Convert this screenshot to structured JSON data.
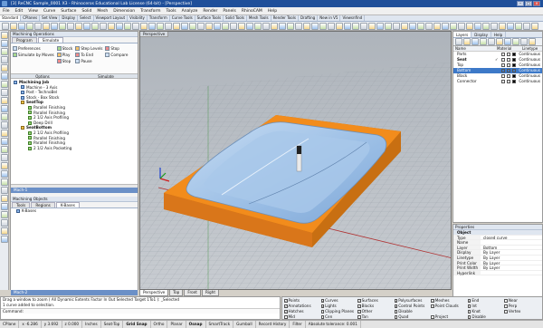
{
  "window": {
    "title": "[3] ReCNC Sample_0001 X3 - Rhinoceros Educational Lab License (64-bit) - [Perspective]"
  },
  "menu": [
    "File",
    "Edit",
    "View",
    "Curve",
    "Surface",
    "Solid",
    "Mesh",
    "Dimension",
    "Transform",
    "Tools",
    "Analyze",
    "Render",
    "Panels",
    "RhinoCAM",
    "Help"
  ],
  "tabs": [
    {
      "label": "Standard",
      "active": true
    },
    {
      "label": "CPlanes"
    },
    {
      "label": "Set View"
    },
    {
      "label": "Display"
    },
    {
      "label": "Select"
    },
    {
      "label": "Viewport Layout"
    },
    {
      "label": "Visibility"
    },
    {
      "label": "Transform"
    },
    {
      "label": "Curve Tools"
    },
    {
      "label": "Surface Tools"
    },
    {
      "label": "Solid Tools"
    },
    {
      "label": "Mesh Tools"
    },
    {
      "label": "Render Tools"
    },
    {
      "label": "Drafting"
    },
    {
      "label": "New in V5"
    },
    {
      "label": "Viewsnfind"
    }
  ],
  "machining": {
    "title": "Machining Operations",
    "tabs": [
      {
        "label": "Program"
      },
      {
        "label": "Simulate",
        "active": true
      }
    ],
    "col1": [
      {
        "label": "Preferences",
        "icon": "preferences-icon"
      },
      {
        "label": "Simulate by Moves",
        "icon": "checkbox-icon"
      }
    ],
    "col2": [
      {
        "label": "Stock",
        "icon": "stock-icon"
      },
      {
        "label": "Play",
        "icon": "play-icon"
      },
      {
        "label": "Stop",
        "icon": "stop-icon"
      }
    ],
    "col3": [
      {
        "label": "Step Levels",
        "icon": "step-levels-icon"
      },
      {
        "label": "To End",
        "icon": "to-end-icon"
      },
      {
        "label": "Pause",
        "icon": "pause-icon"
      }
    ],
    "col4": [
      {
        "label": "Stop",
        "icon": "stop-icon"
      },
      {
        "label": "Compare",
        "icon": "compare-icon"
      }
    ],
    "groups": [
      "Options",
      "Simulate"
    ],
    "tree": [
      {
        "label": "Machining Job",
        "level": 0,
        "bold": true,
        "icon": "job"
      },
      {
        "label": "Machine - 3 Axis",
        "level": 1,
        "icon": "machine"
      },
      {
        "label": "Post - TechnoBel",
        "level": 1,
        "icon": "post"
      },
      {
        "label": "Stock - Box Stock",
        "level": 1,
        "icon": "stock"
      },
      {
        "label": "SeatTop",
        "level": 1,
        "bold": true,
        "icon": "folder"
      },
      {
        "label": "Parallel Finishing",
        "level": 2,
        "icon": "op"
      },
      {
        "label": "Parallel Finishing",
        "level": 2,
        "icon": "op"
      },
      {
        "label": "2 1/2 Axis Profiling",
        "level": 2,
        "icon": "op"
      },
      {
        "label": "Deep Drill",
        "level": 2,
        "icon": "op"
      },
      {
        "label": "SeatBottom",
        "level": 1,
        "bold": true,
        "icon": "folder"
      },
      {
        "label": "2 1/2 Axis Profiling",
        "level": 2,
        "icon": "op"
      },
      {
        "label": "Parallel Finishing",
        "level": 2,
        "icon": "op"
      },
      {
        "label": "Parallel Finishing",
        "level": 2,
        "icon": "op"
      },
      {
        "label": "2 1/2 Axis Pocketing",
        "level": 2,
        "icon": "op"
      }
    ],
    "section_label": "Mach-1"
  },
  "objects": {
    "title": "Machining Objects",
    "tabs": [
      {
        "label": "Tools"
      },
      {
        "label": "Regions"
      },
      {
        "label": "K-Bases",
        "active": true
      }
    ],
    "tree": [
      {
        "label": "K-Bases"
      }
    ],
    "section_label": "Mach-2"
  },
  "viewport": {
    "label": "Perspective",
    "tabs": [
      {
        "label": "Perspective",
        "active": true
      },
      {
        "label": "Top"
      },
      {
        "label": "Front"
      },
      {
        "label": "Right"
      }
    ],
    "stock_color": "#f28c1c",
    "part_color": "#9dbfe2"
  },
  "layers": {
    "tabs": [
      {
        "label": "Layers",
        "active": true
      },
      {
        "label": "Display"
      },
      {
        "label": "Help"
      }
    ],
    "headers": [
      "Name",
      "Material",
      "Linetype"
    ],
    "rows": [
      {
        "name": "Parts",
        "color": "#000000",
        "linetype": "Continuous",
        "current": false
      },
      {
        "name": "Seat",
        "color": "#000000",
        "linetype": "Continuous",
        "current": true,
        "bold": true
      },
      {
        "name": "Top",
        "color": "#000000",
        "linetype": "Continuous",
        "current": false
      },
      {
        "name": "Bottom",
        "color": "#3d79c8",
        "linetype": "Continuous",
        "current": false,
        "selected": true
      },
      {
        "name": "Black",
        "color": "#000000",
        "linetype": "Continuous",
        "current": false
      },
      {
        "name": "Connector",
        "color": "#000000",
        "linetype": "Continuous",
        "current": false
      }
    ]
  },
  "properties": {
    "title": "Properties",
    "section": "Object",
    "rows": [
      {
        "k": "Type",
        "v": "closed curve"
      },
      {
        "k": "Name",
        "v": ""
      },
      {
        "k": "Layer",
        "v": "Bottom"
      },
      {
        "k": "Display Color",
        "v": "By Layer"
      },
      {
        "k": "Linetype",
        "v": "By Layer"
      },
      {
        "k": "Print Color",
        "v": "By Layer"
      },
      {
        "k": "Print Width",
        "v": "By Layer"
      },
      {
        "k": "Hyperlink",
        "v": ""
      }
    ]
  },
  "command": {
    "history": [
      "Drag a window to zoom ( All  Dynamic  Extents  Factor  In  Out  Selected  Target  1To1 ): _Selected",
      "1 curve added to selection."
    ],
    "prompt": "Command:"
  },
  "osnaps": [
    {
      "label": "Points",
      "checked": true
    },
    {
      "label": "Curves",
      "checked": true
    },
    {
      "label": "Surfaces",
      "checked": true
    },
    {
      "label": "Polysurfaces",
      "checked": true
    },
    {
      "label": "Meshes",
      "checked": true
    },
    {
      "label": "End",
      "checked": true
    },
    {
      "label": "Near",
      "checked": false
    },
    {
      "label": "Annotations",
      "checked": true
    },
    {
      "label": "Lights",
      "checked": true
    },
    {
      "label": "Blocks",
      "checked": true
    },
    {
      "label": "Control Points",
      "checked": true
    },
    {
      "label": "Point Clouds",
      "checked": true
    },
    {
      "label": "Int",
      "checked": false
    },
    {
      "label": "Perp",
      "checked": false
    },
    {
      "label": "Hatches",
      "checked": true
    },
    {
      "label": "Clipping Planes",
      "checked": false
    },
    {
      "label": "Other",
      "checked": true
    },
    {
      "label": "Disable",
      "checked": false
    },
    {
      "label": "",
      "checked": false
    },
    {
      "label": "Knot",
      "checked": false
    },
    {
      "label": "Vertex",
      "checked": false
    }
  ],
  "osnap_extra": [
    {
      "label": "Mid",
      "checked": false
    },
    {
      "label": "Cen",
      "checked": false
    },
    {
      "label": "Tan",
      "checked": false
    },
    {
      "label": "Quad",
      "checked": false
    },
    {
      "label": "Project",
      "checked": false
    },
    {
      "label": "Disable",
      "checked": false
    }
  ],
  "status": [
    "CPlane",
    "x -6.286",
    "y 3.692",
    "z 0.000",
    "Inches",
    "Seat-Top",
    "Grid Snap",
    "Ortho",
    "Planar",
    "Osnap",
    "SmartTrack",
    "Gumball",
    "Record History",
    "Filter",
    "Absolute tolerance: 0.001"
  ]
}
